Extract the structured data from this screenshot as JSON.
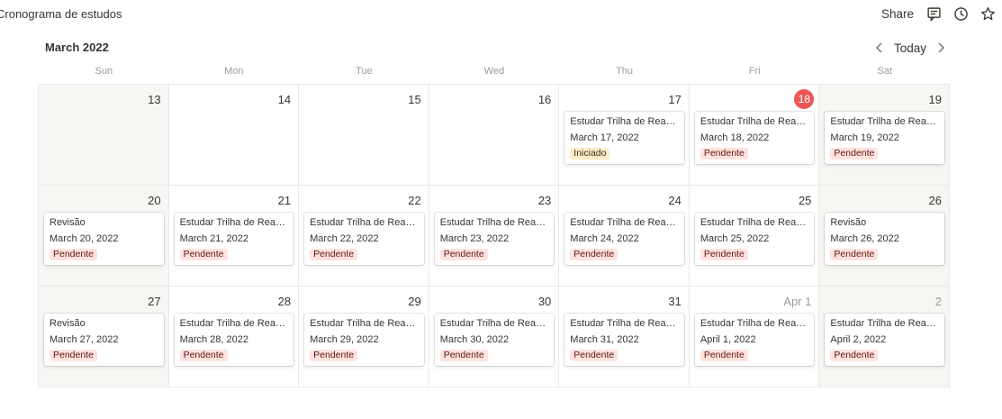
{
  "page": {
    "title": "Cronograma de estudos"
  },
  "topbar": {
    "share_label": "Share",
    "icons": [
      "comment-icon",
      "clock-icon",
      "star-icon"
    ]
  },
  "calendar": {
    "month_label": "March 2022",
    "today_label": "Today",
    "weekdays": [
      "Sun",
      "Mon",
      "Tue",
      "Wed",
      "Thu",
      "Fri",
      "Sat"
    ],
    "colors": {
      "today": "#eb5757",
      "pendente_bg": "#ffe2dd",
      "iniciado_bg": "#fdecc8",
      "weekend_bg": "#f7f6f3"
    },
    "weeks": [
      [
        {
          "day": "13",
          "weekend": true,
          "event": null
        },
        {
          "day": "14",
          "event": null
        },
        {
          "day": "15",
          "event": null
        },
        {
          "day": "16",
          "event": null
        },
        {
          "day": "17",
          "event": {
            "title": "Estudar Trilha de React ...",
            "date": "March 17, 2022",
            "status": "Iniciado"
          }
        },
        {
          "day": "18",
          "today": true,
          "event": {
            "title": "Estudar Trilha de React ...",
            "date": "March 18, 2022",
            "status": "Pendente"
          }
        },
        {
          "day": "19",
          "weekend": true,
          "event": {
            "title": "Estudar Trilha de React ...",
            "date": "March 19, 2022",
            "status": "Pendente"
          }
        }
      ],
      [
        {
          "day": "20",
          "weekend": true,
          "event": {
            "title": "Revisão",
            "date": "March 20, 2022",
            "status": "Pendente"
          }
        },
        {
          "day": "21",
          "event": {
            "title": "Estudar Trilha de React ...",
            "date": "March 21, 2022",
            "status": "Pendente"
          }
        },
        {
          "day": "22",
          "event": {
            "title": "Estudar Trilha de React ...",
            "date": "March 22, 2022",
            "status": "Pendente"
          }
        },
        {
          "day": "23",
          "event": {
            "title": "Estudar Trilha de React ...",
            "date": "March 23, 2022",
            "status": "Pendente"
          }
        },
        {
          "day": "24",
          "event": {
            "title": "Estudar Trilha de React ...",
            "date": "March 24, 2022",
            "status": "Pendente"
          }
        },
        {
          "day": "25",
          "event": {
            "title": "Estudar Trilha de React ...",
            "date": "March 25, 2022",
            "status": "Pendente"
          }
        },
        {
          "day": "26",
          "weekend": true,
          "event": {
            "title": "Revisão",
            "date": "March 26, 2022",
            "status": "Pendente"
          }
        }
      ],
      [
        {
          "day": "27",
          "weekend": true,
          "event": {
            "title": "Revisão",
            "date": "March 27, 2022",
            "status": "Pendente"
          }
        },
        {
          "day": "28",
          "event": {
            "title": "Estudar Trilha de React ...",
            "date": "March 28, 2022",
            "status": "Pendente"
          }
        },
        {
          "day": "29",
          "event": {
            "title": "Estudar Trilha de React ...",
            "date": "March 29, 2022",
            "status": "Pendente"
          }
        },
        {
          "day": "30",
          "event": {
            "title": "Estudar Trilha de React ...",
            "date": "March 30, 2022",
            "status": "Pendente"
          }
        },
        {
          "day": "31",
          "event": {
            "title": "Estudar Trilha de React ...",
            "date": "March 31, 2022",
            "status": "Pendente"
          }
        },
        {
          "day": "Apr 1",
          "muted": true,
          "event": {
            "title": "Estudar Trilha de React ...",
            "date": "April 1, 2022",
            "status": "Pendente"
          }
        },
        {
          "day": "2",
          "muted": true,
          "weekend": true,
          "event": {
            "title": "Estudar Trilha de React ...",
            "date": "April 2, 2022",
            "status": "Pendente"
          }
        }
      ]
    ]
  }
}
